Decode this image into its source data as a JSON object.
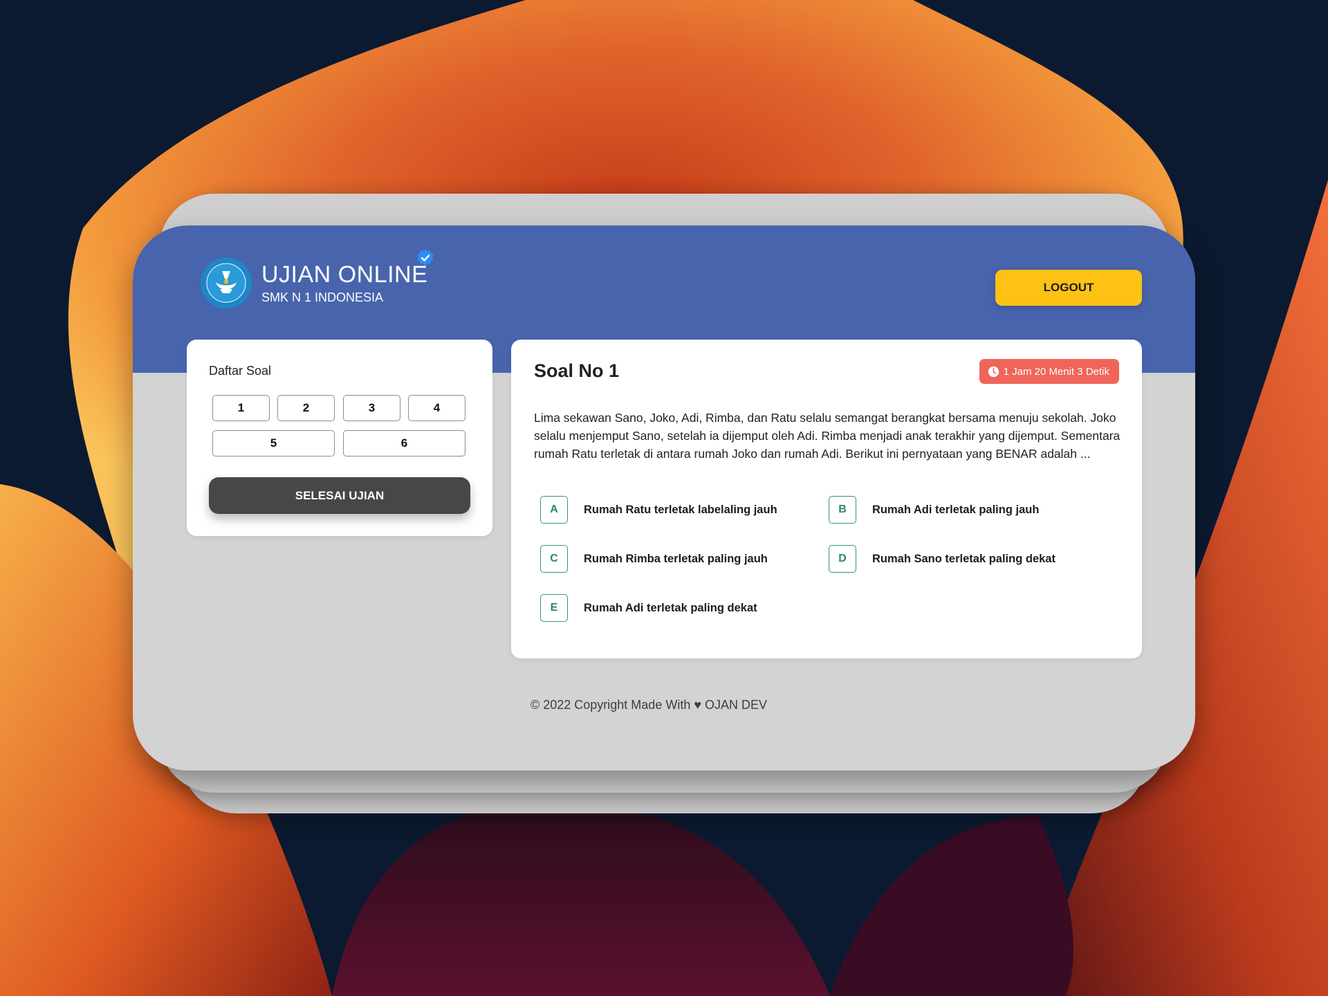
{
  "colors": {
    "header": "#4864ad",
    "logout": "#fdc214",
    "timer": "#f0655a",
    "option_accent": "#2e9a66",
    "finish_button": "#474747",
    "page_background": "#d3d3d3"
  },
  "header": {
    "title": "UJIAN ONLINE",
    "subtitle": "SMK N 1 INDONESIA",
    "logo_icon": "tut-wuri-handayani-logo",
    "verified_icon": "verified-badge-icon",
    "logout_label": "LOGOUT"
  },
  "question_list": {
    "title": "Daftar Soal",
    "numbers": [
      "1",
      "2",
      "3",
      "4",
      "5",
      "6"
    ],
    "finish_label": "SELESAI UJIAN"
  },
  "question": {
    "heading": "Soal No 1",
    "timer_icon": "clock-icon",
    "timer": "1 Jam 20 Menit 3 Detik",
    "text": "Lima sekawan Sano, Joko, Adi, Rimba, dan Ratu selalu semangat berangkat bersama menuju sekolah. Joko selalu menjemput Sano, setelah ia dijemput oleh Adi. Rimba menjadi anak terakhir yang dijemput. Sementara rumah Ratu terletak di antara rumah Joko dan rumah Adi. Berikut ini pernyataan yang BENAR adalah ...",
    "options": [
      {
        "letter": "A",
        "text": "Rumah Ratu terletak labelaling jauh"
      },
      {
        "letter": "B",
        "text": "Rumah Adi terletak paling jauh"
      },
      {
        "letter": "C",
        "text": "Rumah Rimba terletak paling jauh"
      },
      {
        "letter": "D",
        "text": "Rumah Sano terletak paling dekat"
      },
      {
        "letter": "E",
        "text": "Rumah Adi terletak paling dekat"
      }
    ]
  },
  "footer": {
    "text": "© 2022 Copyright Made With ♥ OJAN DEV"
  }
}
